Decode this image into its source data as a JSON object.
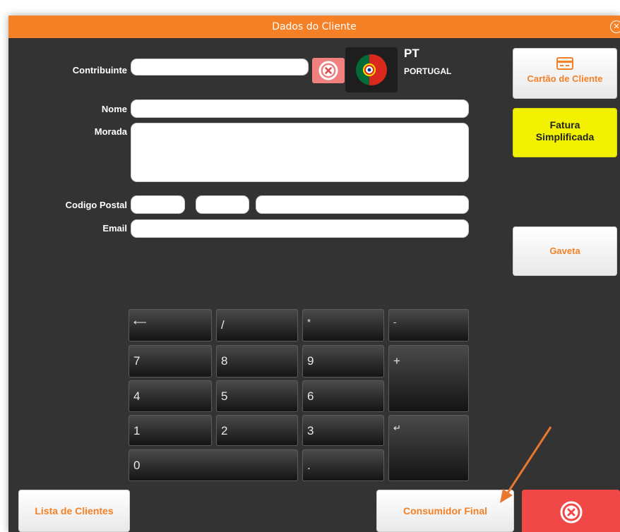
{
  "dialog": {
    "title": "Dados do Cliente",
    "close_icon": "close-circle-icon"
  },
  "form": {
    "contribuinte_label": "Contribuinte",
    "contribuinte_value": "",
    "nome_label": "Nome",
    "nome_value": "",
    "morada_label": "Morada",
    "morada_value": "",
    "codigo_postal_label": "Codigo Postal",
    "codigo_postal_part1": "",
    "codigo_postal_part2": "",
    "codigo_postal_locality": "",
    "email_label": "Email",
    "email_value": ""
  },
  "country": {
    "code": "PT",
    "name": "PORTUGAL",
    "flag_icon": "portugal-flag-icon"
  },
  "side_buttons": {
    "cartao_label": "Cartão de Cliente",
    "cartao_icon": "card-icon",
    "fatura_line1": "Fatura",
    "fatura_line2": "Simplificada",
    "gaveta_label": "Gaveta"
  },
  "keypad": {
    "backspace": "⟵",
    "slash": "/",
    "asterisk": "*",
    "minus": "-",
    "k7": "7",
    "k8": "8",
    "k9": "9",
    "plus": "+",
    "k4": "4",
    "k5": "5",
    "k6": "6",
    "k1": "1",
    "k2": "2",
    "k3": "3",
    "enter": "↵",
    "k0": "0",
    "dot": "."
  },
  "bottom": {
    "lista_label": "Lista de Clientes",
    "consumidor_label": "Consumidor Final",
    "cancel_icon": "close-circle-icon"
  },
  "colors": {
    "accent": "#f58025",
    "background": "#333333",
    "danger": "#f04747",
    "highlight": "#f2f200"
  }
}
